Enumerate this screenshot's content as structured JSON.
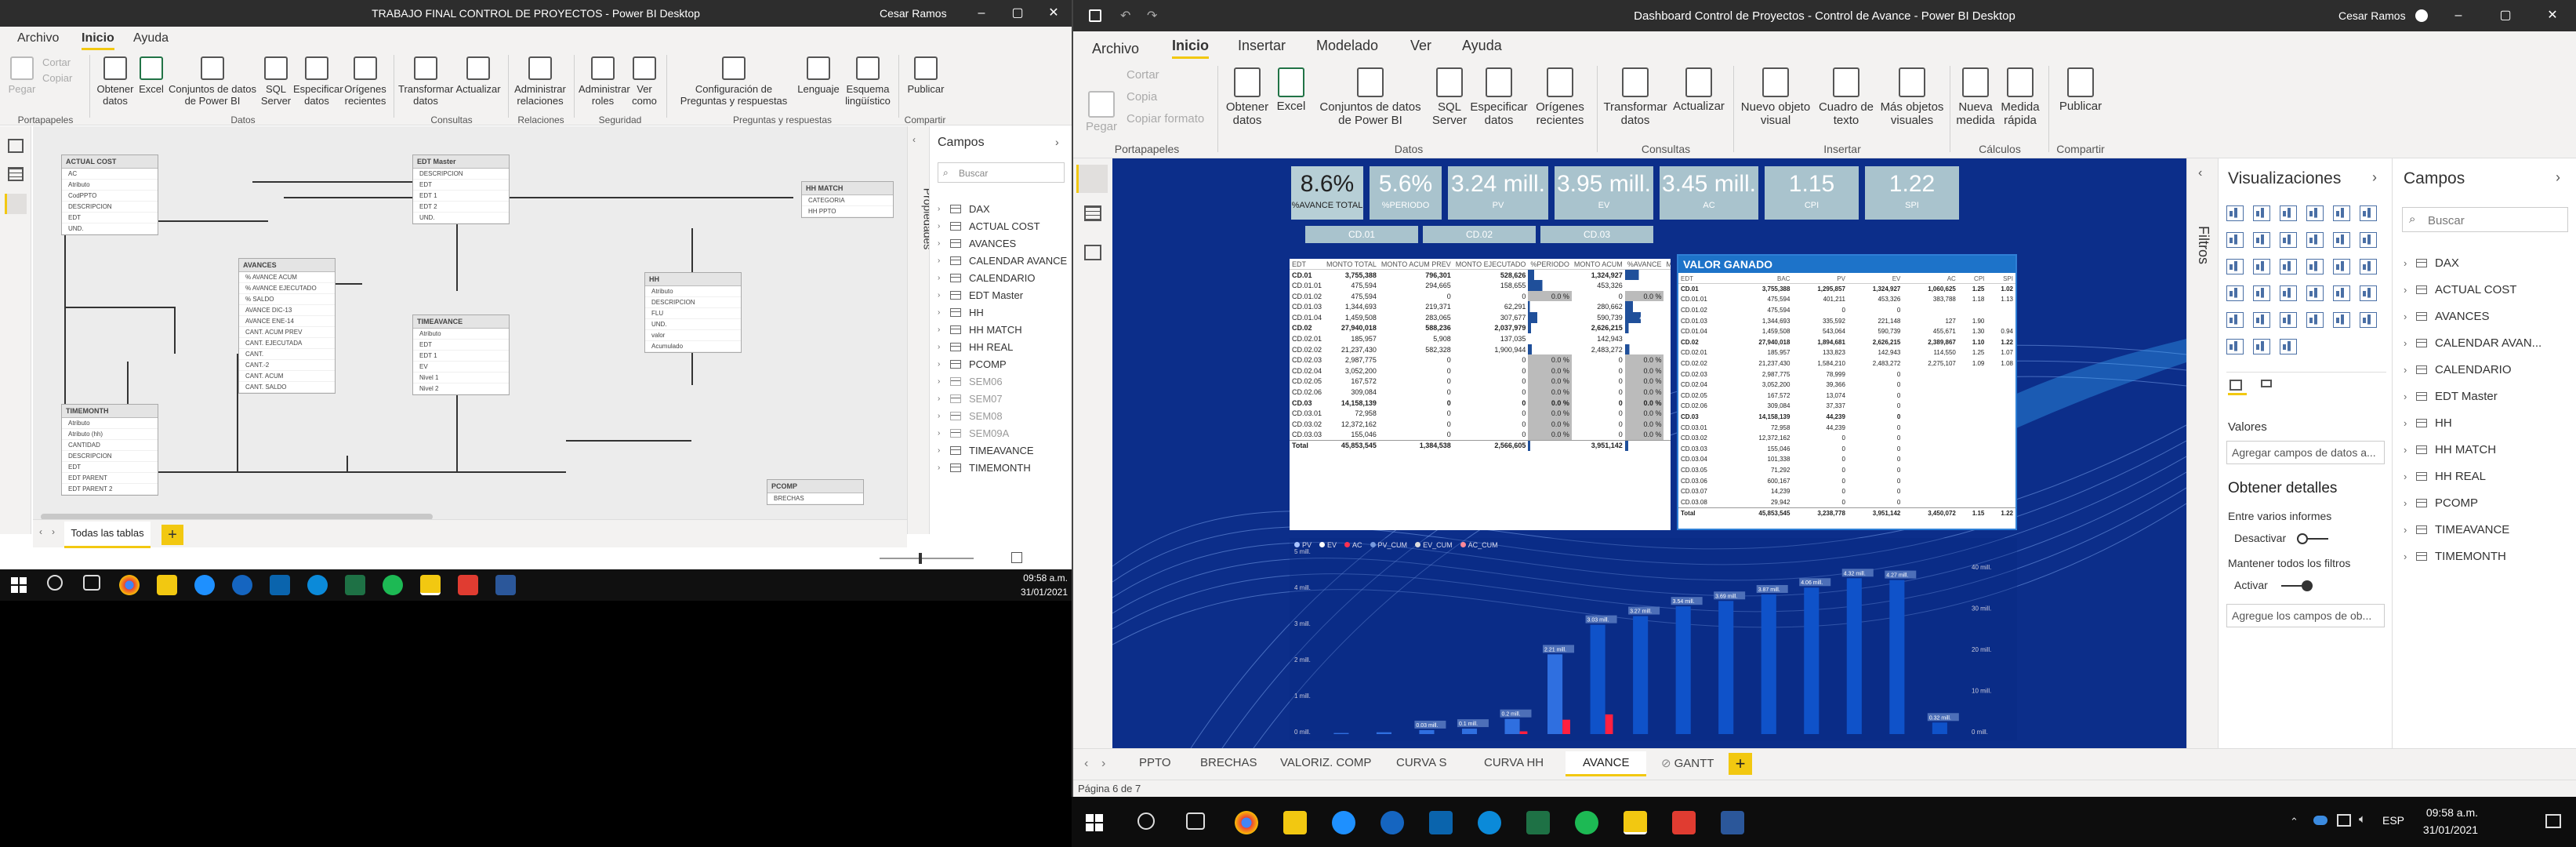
{
  "left_window": {
    "title": "TRABAJO FINAL CONTROL DE PROYECTOS - Power BI Desktop",
    "user": "Cesar Ramos",
    "menu": [
      "Archivo",
      "Inicio",
      "Ayuda"
    ],
    "ribbon": {
      "pegar": "Pegar",
      "cortar": "Cortar",
      "copiar": "Copiar",
      "buttons": [
        "Obtener datos",
        "Excel",
        "Conjuntos de datos de Power BI",
        "SQL Server",
        "Especificar datos",
        "Orígenes recientes",
        "Transformar datos",
        "Actualizar",
        "Administrar relaciones",
        "Administrar roles",
        "Ver como",
        "Configuración de Preguntas y respuestas",
        "Lenguaje",
        "Esquema lingüístico",
        "Publicar"
      ],
      "groups": [
        "Portapapeles",
        "Datos",
        "Consultas",
        "Relaciones",
        "Seguridad",
        "Preguntas y respuestas",
        "Compartir"
      ]
    },
    "model_tables": [
      {
        "name": "ACTUAL COST",
        "fields": [
          "AC",
          "Atributo",
          "CodPPTO",
          "DESCRIPCION",
          "EDT",
          "UND."
        ]
      },
      {
        "name": "EDT Master",
        "fields": [
          "DESCRIPCION",
          "EDT",
          "EDT 1",
          "EDT 2",
          "UND."
        ]
      },
      {
        "name": "HH MATCH",
        "fields": [
          "CATEGORIA",
          "HH PPTO"
        ]
      },
      {
        "name": "AVANCES",
        "fields": [
          "% AVANCE ACUM",
          "% AVANCE EJECUTADO",
          "% SALDO",
          "AVANCE DIC-13",
          "AVANCE ENE-14",
          "CANT. ACUM PREV",
          "CANT. EJECUTADA",
          "CANT.",
          "CANT.-2",
          "CANT. ACUM",
          "CANT. SALDO"
        ]
      },
      {
        "name": "TIMEAVANCE",
        "fields": [
          "Atributo",
          "EDT",
          "EDT 1",
          "EV",
          "Nivel 1",
          "Nivel 2"
        ]
      },
      {
        "name": "HH",
        "fields": [
          "Atributo",
          "DESCRIPCION",
          "FLU",
          "UND.",
          "valor",
          "Acumulado"
        ]
      },
      {
        "name": "TIMEMONTH",
        "fields": [
          "Atributo",
          "Atributo (hh)",
          "CANTIDAD",
          "DESCRIPCION",
          "EDT",
          "EDT PARENT",
          "EDT PARENT 2"
        ]
      },
      {
        "name": "PCOMP",
        "fields": [
          "BRECHAS"
        ]
      }
    ],
    "propiedades": "Propiedades",
    "campos": {
      "title": "Campos",
      "search_placeholder": "Buscar",
      "items": [
        "DAX",
        "ACTUAL COST",
        "AVANCES",
        "CALENDAR AVANCE",
        "CALENDARIO",
        "EDT Master",
        "HH",
        "HH MATCH",
        "HH REAL",
        "PCOMP",
        "SEM06",
        "SEM07",
        "SEM08",
        "SEM09A",
        "TIMEAVANCE",
        "TIMEMONTH"
      ]
    },
    "tab": "Todas las tablas",
    "taskbar_time": "09:58 a.m.",
    "taskbar_date": "31/01/2021"
  },
  "right_window": {
    "title": "Dashboard Control de Proyectos - Control de Avance - Power BI Desktop",
    "user": "Cesar Ramos",
    "menu": [
      "Archivo",
      "Inicio",
      "Insertar",
      "Modelado",
      "Ver",
      "Ayuda"
    ],
    "ribbon": {
      "pegar": "Pegar",
      "cortar": "Cortar",
      "copia": "Copia",
      "copiar_formato": "Copiar formato",
      "buttons": [
        "Obtener datos",
        "Excel",
        "Conjuntos de datos de Power BI",
        "SQL Server",
        "Especificar datos",
        "Orígenes recientes",
        "Transformar datos",
        "Actualizar",
        "Nuevo objeto visual",
        "Cuadro de texto",
        "Más objetos visuales",
        "Nueva medida",
        "Medida rápida",
        "Publicar"
      ],
      "groups": [
        "Portapapeles",
        "Datos",
        "Consultas",
        "Insertar",
        "Cálculos",
        "Compartir"
      ]
    },
    "kpis": [
      {
        "value": "8.6%",
        "label": "%AVANCE TOTAL"
      },
      {
        "value": "5.6%",
        "label": "%PERIODO"
      },
      {
        "value": "3.24 mill.",
        "label": "PV"
      },
      {
        "value": "3.95 mill.",
        "label": "EV"
      },
      {
        "value": "3.45 mill.",
        "label": "AC"
      },
      {
        "value": "1.15",
        "label": "CPI"
      },
      {
        "value": "1.22",
        "label": "SPI"
      }
    ],
    "slicers": [
      "CD.01",
      "CD.02",
      "CD.03"
    ],
    "matrix1": {
      "headers": [
        "EDT",
        "MONTO TOTAL",
        "MONTO ACUM PREV",
        "MONTO EJECUTADO",
        "%PERIODO",
        "MONTO ACUM",
        "%AVANCE",
        "MONTO SALDO"
      ],
      "rows": [
        [
          "CD.01",
          "3,755,388",
          "796,301",
          "528,626",
          "14.1 %",
          "1,324,927",
          "35.3 %",
          "2,430,461"
        ],
        [
          "CD.01.01",
          "475,594",
          "294,665",
          "158,655",
          "33.4 %",
          "453,326",
          "",
          "22,068"
        ],
        [
          "CD.01.02",
          "475,594",
          "0",
          "0",
          "0.0 %",
          "0",
          "0.0 %",
          "475,594"
        ],
        [
          "CD.01.03",
          "1,344,693",
          "219,371",
          "62,291",
          "4.6 %",
          "280,662",
          "20.9 %",
          "1,064,231"
        ],
        [
          "CD.01.04",
          "1,459,508",
          "283,065",
          "307,677",
          "21.1 %",
          "590,739",
          "40.5 %",
          "868,569"
        ],
        [
          "CD.02",
          "27,940,018",
          "588,236",
          "2,037,979",
          "7.3 %",
          "2,626,215",
          "9.4 %",
          "25,313,802"
        ],
        [
          "CD.02.01",
          "185,957",
          "5,908",
          "137,035",
          "",
          "142,943",
          "",
          "43,014"
        ],
        [
          "CD.02.02",
          "21,237,430",
          "582,328",
          "1,900,944",
          "9.0 %",
          "2,483,272",
          "11.7 %",
          "18,754,158"
        ],
        [
          "CD.02.03",
          "2,987,775",
          "0",
          "0",
          "0.0 %",
          "0",
          "0.0 %",
          "2,987,775"
        ],
        [
          "CD.02.04",
          "3,052,200",
          "0",
          "0",
          "0.0 %",
          "0",
          "0.0 %",
          "3,052,200"
        ],
        [
          "CD.02.05",
          "167,572",
          "0",
          "0",
          "0.0 %",
          "0",
          "0.0 %",
          "167,572"
        ],
        [
          "CD.02.06",
          "309,084",
          "0",
          "0",
          "0.0 %",
          "0",
          "0.0 %",
          "309,084"
        ],
        [
          "CD.03",
          "14,158,139",
          "0",
          "0",
          "0.0 %",
          "0",
          "0.0 %",
          "14,158,139"
        ],
        [
          "CD.03.01",
          "72,958",
          "0",
          "0",
          "0.0 %",
          "0",
          "0.0 %",
          "72,958"
        ],
        [
          "CD.03.02",
          "12,372,162",
          "0",
          "0",
          "0.0 %",
          "0",
          "0.0 %",
          "12,372,162"
        ],
        [
          "CD.03.03",
          "155,046",
          "0",
          "0",
          "0.0 %",
          "0",
          "0.0 %",
          "155,046"
        ],
        [
          "Total",
          "45,853,545",
          "1,384,538",
          "2,566,605",
          "5.6 %",
          "3,951,142",
          "8.6 %",
          "41,902,402"
        ]
      ]
    },
    "matrix2": {
      "title": "VALOR GANADO",
      "headers": [
        "EDT",
        "BAC",
        "PV",
        "EV",
        "AC",
        "CPI",
        "SPI"
      ],
      "rows": [
        [
          "CD.01",
          "3,755,388",
          "1,295,857",
          "1,324,927",
          "1,060,625",
          "1.25",
          "1.02"
        ],
        [
          "CD.01.01",
          "475,594",
          "401,211",
          "453,326",
          "383,788",
          "1.18",
          "1.13"
        ],
        [
          "CD.01.02",
          "475,594",
          "0",
          "0",
          "",
          "",
          ""
        ],
        [
          "CD.01.03",
          "1,344,693",
          "335,592",
          "221,148",
          "127",
          "1.90",
          ""
        ],
        [
          "CD.01.04",
          "1,459,508",
          "543,064",
          "590,739",
          "455,671",
          "1.30",
          "0.94"
        ],
        [
          "CD.02",
          "27,940,018",
          "1,894,681",
          "2,626,215",
          "2,389,867",
          "1.10",
          "1.22"
        ],
        [
          "CD.02.01",
          "185,957",
          "133,823",
          "142,943",
          "114,550",
          "1.25",
          "1.07"
        ],
        [
          "CD.02.02",
          "21,237,430",
          "1,584,210",
          "2,483,272",
          "2,275,107",
          "1.09",
          "1.08"
        ],
        [
          "CD.02.03",
          "2,987,775",
          "78,999",
          "0",
          "",
          "",
          ""
        ],
        [
          "CD.02.04",
          "3,052,200",
          "39,366",
          "0",
          "",
          "",
          ""
        ],
        [
          "CD.02.05",
          "167,572",
          "13,074",
          "0",
          "",
          "",
          ""
        ],
        [
          "CD.02.06",
          "309,084",
          "37,337",
          "0",
          "",
          "",
          ""
        ],
        [
          "CD.03",
          "14,158,139",
          "44,239",
          "0",
          "",
          "",
          ""
        ],
        [
          "CD.03.01",
          "72,958",
          "44,239",
          "0",
          "",
          "",
          ""
        ],
        [
          "CD.03.02",
          "12,372,162",
          "0",
          "0",
          "",
          "",
          ""
        ],
        [
          "CD.03.03",
          "155,046",
          "0",
          "0",
          "",
          "",
          ""
        ],
        [
          "CD.03.04",
          "101,338",
          "0",
          "0",
          "",
          "",
          ""
        ],
        [
          "CD.03.05",
          "71,292",
          "0",
          "0",
          "",
          "",
          ""
        ],
        [
          "CD.03.06",
          "600,167",
          "0",
          "0",
          "",
          "",
          ""
        ],
        [
          "CD.03.07",
          "14,239",
          "0",
          "0",
          "",
          "",
          ""
        ],
        [
          "CD.03.08",
          "29,942",
          "0",
          "0",
          "",
          "",
          ""
        ],
        [
          "Total",
          "45,853,545",
          "3,238,778",
          "3,951,142",
          "3,450,072",
          "1.15",
          "1.22"
        ]
      ]
    },
    "chart_data": {
      "type": "bar",
      "legend": [
        "PV",
        "EV",
        "AC",
        "PV_CUM",
        "EV_CUM",
        "AC_CUM"
      ],
      "y_left_ticks": [
        "0 mill.",
        "1 mill.",
        "2 mill.",
        "3 mill.",
        "4 mill.",
        "5 mill."
      ],
      "y_right_ticks": [
        "0 mill.",
        "10 mill.",
        "20 mill.",
        "30 mill.",
        "40 mill."
      ],
      "bars_cum": [
        0.03,
        0.05,
        0.11,
        0.15,
        0.42,
        2.21,
        3.03,
        3.27,
        3.54,
        3.69,
        3.87,
        4.06,
        4.32,
        4.27,
        0.32
      ],
      "bar_labels": [
        "0.03 mill.",
        "0.1 mill.",
        "0.2 mill.",
        "2.21 mill.",
        "3.03 mill.",
        "3.27 mill.",
        "3.54 mill.",
        "3.69 mill.",
        "3.87 mill.",
        "4.06 mill.",
        "4.32 mill.",
        "4.27 mill.",
        "0.32 mill."
      ]
    },
    "right_panes": {
      "filtros": "Filtros",
      "visualizaciones": "Visualizaciones",
      "valores": "Valores",
      "valores_placeholder": "Agregar campos de datos a...",
      "obtener_detalles": "Obtener detalles",
      "varios_informes": "Entre varios informes",
      "desactivar": "Desactivar",
      "mantener": "Mantener todos los filtros",
      "activar": "Activar",
      "agregue": "Agregue los campos de ob...",
      "campos_title": "Campos",
      "search_placeholder": "Buscar",
      "campos": [
        "DAX",
        "ACTUAL COST",
        "AVANCES",
        "CALENDAR AVAN...",
        "CALENDARIO",
        "EDT Master",
        "HH",
        "HH MATCH",
        "HH REAL",
        "PCOMP",
        "TIMEAVANCE",
        "TIMEMONTH"
      ]
    },
    "pages": [
      "PPTO",
      "BRECHAS",
      "VALORIZ. COMP",
      "CURVA S",
      "CURVA HH",
      "AVANCE",
      "GANTT"
    ],
    "active_page": "AVANCE",
    "status": "Página 6 de 7",
    "taskbar_time": "09:58 a.m.",
    "taskbar_date": "31/01/2021",
    "taskbar_lang": "ESP"
  }
}
